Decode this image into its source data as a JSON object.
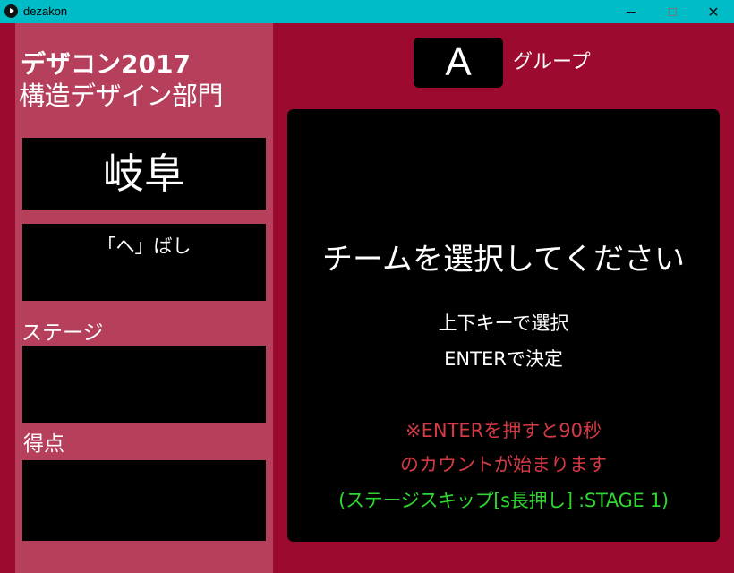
{
  "window": {
    "title": "dezakon",
    "icon": "play-circle-icon",
    "controls": {
      "minimize": "minimize-icon",
      "maximize": "maximize-icon",
      "close": "close-icon"
    },
    "colors": {
      "titlebar": "#00bcc6",
      "background": "#9d0a2f",
      "side_panel": "#b63f5c"
    }
  },
  "sidebar": {
    "contest_title": "デザコン2017",
    "contest_subtitle": "構造デザイン部門",
    "team_region": "岐阜",
    "team_name": "「へ」ばし",
    "stage_label": "ステージ",
    "stage_value": "",
    "score_label": "得点",
    "score_value": ""
  },
  "group": {
    "letter": "A",
    "label": "グループ"
  },
  "main": {
    "prompt": "チームを選択してください",
    "instruction_select": "上下キーで選択",
    "instruction_confirm": "ENTERで決定",
    "warning_line1": "※ENTERを押すと90秒",
    "warning_line2": "のカウントが始まります",
    "skip_hint": "(ステージスキップ[s長押し] :STAGE 1)",
    "colors": {
      "warning": "#d43a45",
      "skip_hint": "#2fd62f"
    }
  }
}
